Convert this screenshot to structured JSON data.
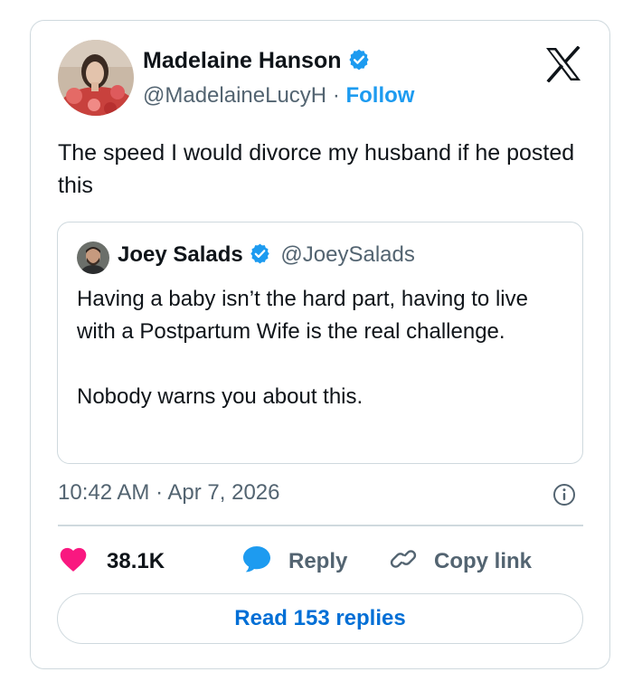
{
  "author": {
    "name": "Madelaine Hanson",
    "handle": "@MadelaineLucyH",
    "separator": "·",
    "follow_label": "Follow",
    "verified": true
  },
  "tweet": {
    "text": "The speed I would divorce my husband if he posted this"
  },
  "quoted_tweet": {
    "name": "Joey Salads",
    "handle": "@JoeySalads",
    "verified": true,
    "paragraphs": [
      "Having a baby isn’t the hard part, having to live with a Postpartum Wife is the real challenge.",
      "Nobody warns you about this."
    ]
  },
  "timestamp": "10:42 AM · Apr 7, 2026",
  "actions": {
    "like_count": "38.1K",
    "reply_label": "Reply",
    "copy_link_label": "Copy link"
  },
  "read_replies_label": "Read 153 replies",
  "icons": {
    "platform": "x-logo-icon",
    "verified": "verified-badge-icon",
    "info": "info-icon",
    "like": "heart-icon",
    "reply": "speech-bubble-icon",
    "copy": "link-icon"
  },
  "colors": {
    "accent": "#1d9bf0",
    "like": "#f91880",
    "muted_text": "#536471",
    "border": "#cfd9de",
    "replies_link": "#006fd6"
  }
}
